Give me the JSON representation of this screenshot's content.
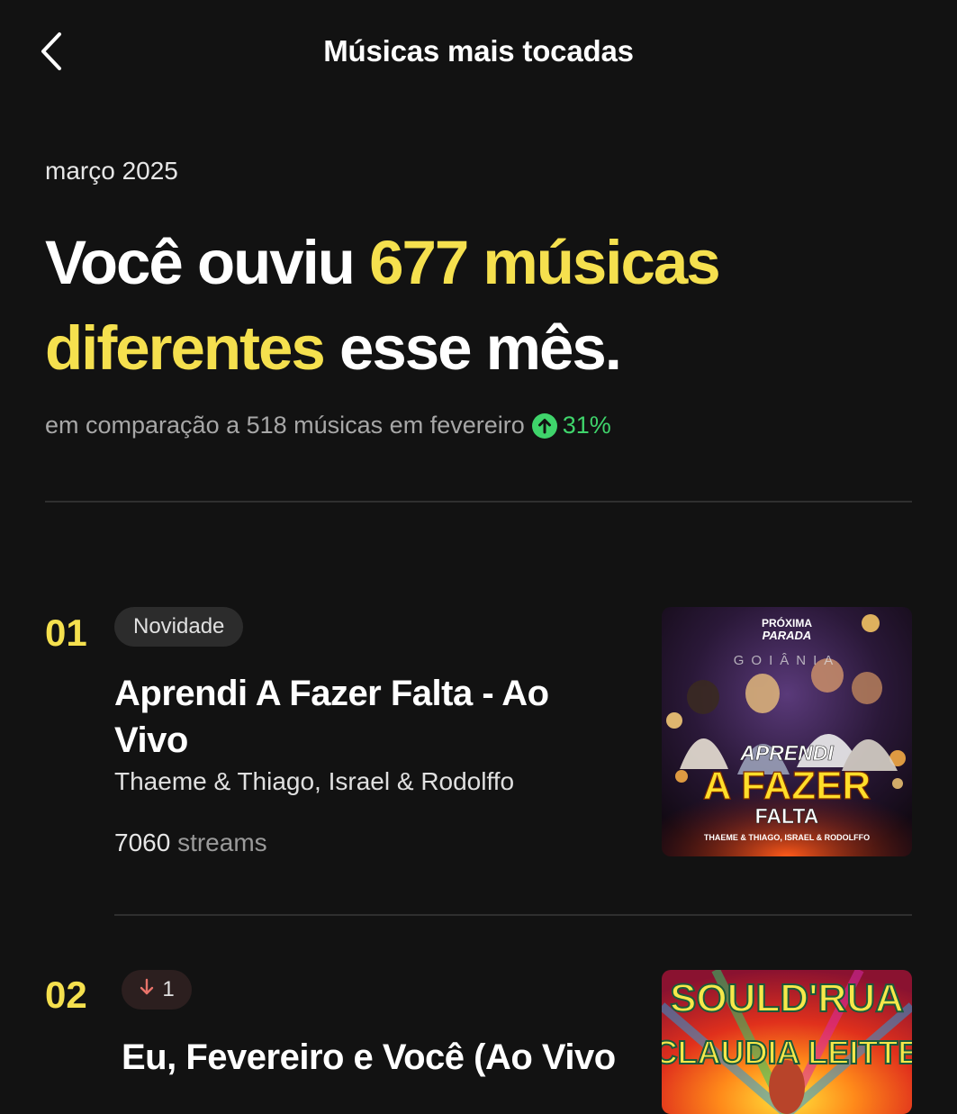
{
  "header": {
    "title": "Músicas mais tocadas"
  },
  "summary": {
    "period": "março 2025",
    "headline_prefix": "Você ouviu ",
    "headline_highlight": "677 músicas diferentes",
    "headline_suffix": " esse mês.",
    "comparison_text": "em comparação a 518 músicas em fevereiro",
    "comparison_pct": "31%",
    "comparison_direction": "up"
  },
  "tracks": [
    {
      "rank": "01",
      "badge": "Novidade",
      "title": "Aprendi A Fazer Falta - Ao Vivo",
      "artist": "Thaeme & Thiago, Israel & Rodolffo",
      "streams_count": "7060",
      "streams_label": "streams",
      "art_text": {
        "logo_line1": "PRÓXIMA",
        "logo_line2": "PARADA",
        "venue": "GOIÂNIA",
        "title_line1": "APRENDI",
        "title_line2": "A FAZER",
        "title_line3": "FALTA",
        "credits": "THAEME & THIAGO, ISRAEL & RODOLFFO"
      }
    },
    {
      "rank": "02",
      "badge_change": "1",
      "badge_direction": "down",
      "title": "Eu, Fevereiro e Você (Ao Vivo",
      "art_text": {
        "line1": "SOULD'RUA",
        "line2": "CLAUDIA LEITTE"
      }
    }
  ],
  "colors": {
    "background": "#121212",
    "accent_yellow": "#f5e04e",
    "positive_green": "#3fd46b",
    "muted_text": "#a7a7a7"
  },
  "icons": {
    "back": "chevron-left-icon",
    "trend_up": "arrow-up-circle-icon",
    "trend_down": "arrow-down-icon"
  }
}
